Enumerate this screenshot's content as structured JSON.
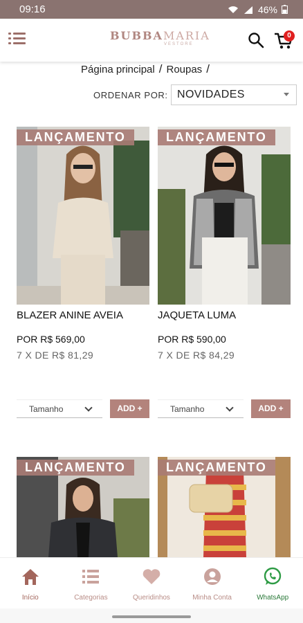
{
  "status_bar": {
    "time": "09:16",
    "battery": "46%"
  },
  "header": {
    "logo_main_1": "BUBBA",
    "logo_main_2": "MARIA",
    "logo_sub": "VESTORE",
    "cart_count": "0"
  },
  "breadcrumb": [
    {
      "label": "Página principal"
    },
    {
      "label": "Roupas"
    }
  ],
  "sort": {
    "label": "ORDENAR POR:",
    "value": "NOVIDADES"
  },
  "products": [
    {
      "badge": "LANÇAMENTO",
      "name": "BLAZER ANINE AVEIA",
      "price": "POR R$ 569,00",
      "installments": "7 X  DE R$ 81,29",
      "size_placeholder": "Tamanho",
      "add_label": "ADD +"
    },
    {
      "badge": "LANÇAMENTO",
      "name": "JAQUETA LUMA",
      "price": "POR R$ 590,00",
      "installments": "7 X  DE R$ 84,29",
      "size_placeholder": "Tamanho",
      "add_label": "ADD +"
    },
    {
      "badge": "LANÇAMENTO"
    },
    {
      "badge": "LANÇAMENTO"
    }
  ],
  "bottom_nav": [
    {
      "label": "Início",
      "icon": "home-icon"
    },
    {
      "label": "Categorias",
      "icon": "list-icon"
    },
    {
      "label": "Queridinhos",
      "icon": "heart-icon"
    },
    {
      "label": "Minha Conta",
      "icon": "user-icon"
    },
    {
      "label": "WhatsApp",
      "icon": "whatsapp-icon"
    }
  ],
  "colors": {
    "brand": "#b3837c",
    "status_bar": "#8a7370",
    "badge": "#e02020",
    "whatsapp": "#2b7a3a"
  }
}
